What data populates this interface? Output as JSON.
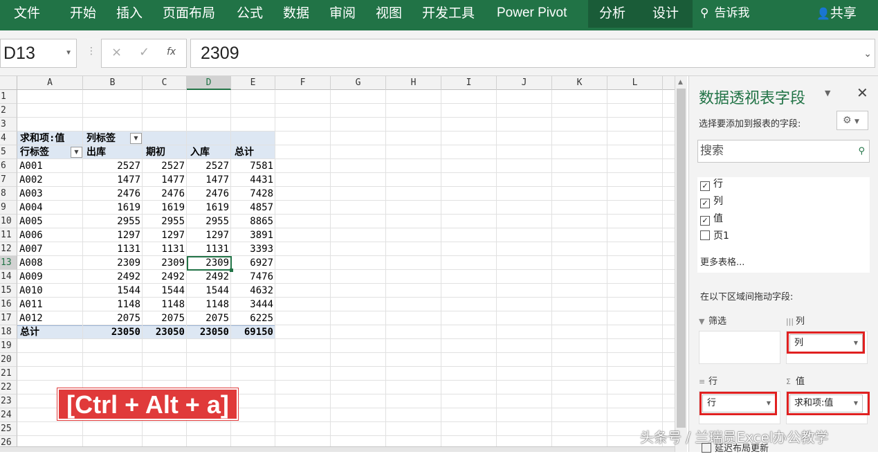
{
  "ribbon": {
    "tabs": [
      "文件",
      "开始",
      "插入",
      "页面布局",
      "公式",
      "数据",
      "审阅",
      "视图",
      "开发工具",
      "Power Pivot",
      "分析",
      "设计"
    ],
    "tell_me": "告诉我",
    "share": "共享"
  },
  "formula_bar": {
    "name_box": "D13",
    "cancel_icon": "×",
    "enter_icon": "✓",
    "fx": "fx",
    "value": "2309"
  },
  "sheet": {
    "columns": [
      "A",
      "B",
      "C",
      "D",
      "E",
      "F",
      "G",
      "H",
      "I",
      "J",
      "K",
      "L"
    ],
    "selected_column": "D",
    "rows": [
      "1",
      "2",
      "3",
      "4",
      "5",
      "6",
      "7",
      "8",
      "9",
      "10",
      "11",
      "12",
      "13",
      "14",
      "15",
      "16",
      "17",
      "18",
      "19",
      "20",
      "21",
      "22",
      "23",
      "24",
      "25",
      "26"
    ],
    "selected_row": "13",
    "pivot": {
      "value_label": "求和项:值",
      "col_labels_label": "列标签",
      "row_labels_label": "行标签",
      "headers": [
        "出库",
        "期初",
        "入库",
        "总计"
      ],
      "rows": [
        {
          "label": "A001",
          "values": [
            "2527",
            "2527",
            "2527",
            "7581"
          ]
        },
        {
          "label": "A002",
          "values": [
            "1477",
            "1477",
            "1477",
            "4431"
          ]
        },
        {
          "label": "A003",
          "values": [
            "2476",
            "2476",
            "2476",
            "7428"
          ]
        },
        {
          "label": "A004",
          "values": [
            "1619",
            "1619",
            "1619",
            "4857"
          ]
        },
        {
          "label": "A005",
          "values": [
            "2955",
            "2955",
            "2955",
            "8865"
          ]
        },
        {
          "label": "A006",
          "values": [
            "1297",
            "1297",
            "1297",
            "3891"
          ]
        },
        {
          "label": "A007",
          "values": [
            "1131",
            "1131",
            "1131",
            "3393"
          ]
        },
        {
          "label": "A008",
          "values": [
            "2309",
            "2309",
            "2309",
            "6927"
          ]
        },
        {
          "label": "A009",
          "values": [
            "2492",
            "2492",
            "2492",
            "7476"
          ]
        },
        {
          "label": "A010",
          "values": [
            "1544",
            "1544",
            "1544",
            "4632"
          ]
        },
        {
          "label": "A011",
          "values": [
            "1148",
            "1148",
            "1148",
            "3444"
          ]
        },
        {
          "label": "A012",
          "values": [
            "2075",
            "2075",
            "2075",
            "6225"
          ]
        }
      ],
      "total_label": "总计",
      "totals": [
        "23050",
        "23050",
        "23050",
        "69150"
      ]
    },
    "shortcut_banner": "[Ctrl + Alt + a]"
  },
  "field_pane": {
    "title": "数据透视表字段",
    "choose_label": "选择要添加到报表的字段:",
    "search_placeholder": "搜索",
    "fields": [
      {
        "name": "行",
        "checked": true
      },
      {
        "name": "列",
        "checked": true
      },
      {
        "name": "值",
        "checked": true
      },
      {
        "name": "页1",
        "checked": false
      }
    ],
    "more_tables": "更多表格...",
    "drag_tip": "在以下区域间拖动字段:",
    "areas": {
      "filters": {
        "label": "筛选",
        "items": []
      },
      "columns": {
        "label": "列",
        "items": [
          "列"
        ]
      },
      "rows": {
        "label": "行",
        "items": [
          "行"
        ]
      },
      "values": {
        "label": "值",
        "items": [
          "求和项:值"
        ]
      }
    },
    "defer_update": "延迟布局更新"
  },
  "watermark": "头条号 / 兰瑞员Excel办公教学",
  "colors": {
    "ribbon": "#217346",
    "pivot_band": "#dde7f3",
    "highlight_red": "#e03a3a",
    "accent_box": "#e02020"
  }
}
